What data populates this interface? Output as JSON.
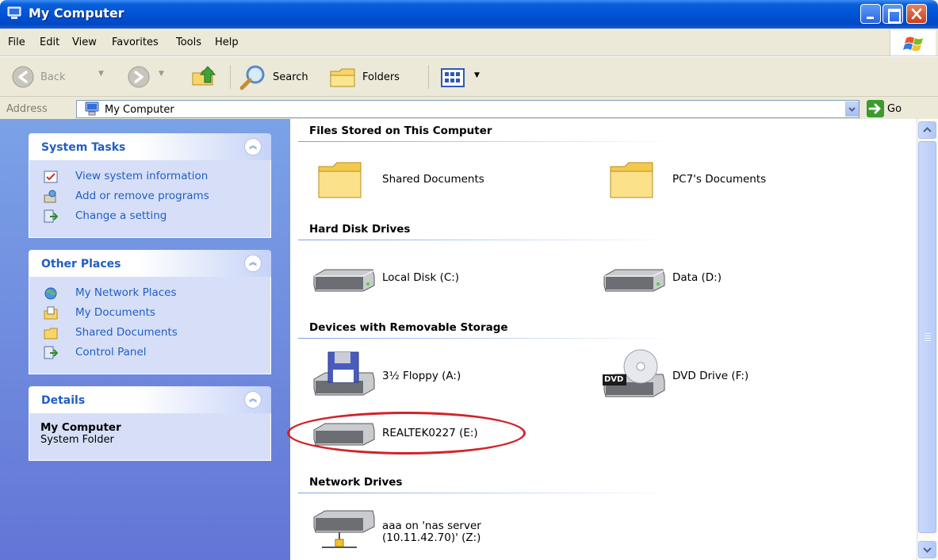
{
  "window": {
    "title": "My Computer"
  },
  "menu": [
    "File",
    "Edit",
    "View",
    "Favorites",
    "Tools",
    "Help"
  ],
  "toolbar": {
    "back_label": "Back",
    "search_label": "Search",
    "folders_label": "Folders"
  },
  "address": {
    "label": "Address",
    "value": "My Computer",
    "go_label": "Go"
  },
  "sidebar": {
    "system_tasks": {
      "title": "System Tasks",
      "items": [
        "View system information",
        "Add or remove programs",
        "Change a setting"
      ]
    },
    "other_places": {
      "title": "Other Places",
      "items": [
        "My Network Places",
        "My Documents",
        "Shared Documents",
        "Control Panel"
      ]
    },
    "details": {
      "title": "Details",
      "name": "My Computer",
      "type": "System Folder"
    }
  },
  "groups": {
    "files": {
      "title": "Files Stored on This Computer",
      "items": [
        "Shared Documents",
        "PC7's Documents"
      ]
    },
    "hdd": {
      "title": "Hard Disk Drives",
      "items": [
        "Local Disk (C:)",
        "Data (D:)"
      ]
    },
    "removable": {
      "title": "Devices with Removable Storage",
      "items": [
        "3½ Floppy (A:)",
        "DVD Drive (F:)",
        "REALTEK0227 (E:)"
      ],
      "dvd_badge": "DVD"
    },
    "network": {
      "title": "Network Drives",
      "item_line1": "aaa on 'nas server",
      "item_line2": "(10.11.42.70)' (Z:)"
    }
  },
  "annotation_color": "#d0242a"
}
